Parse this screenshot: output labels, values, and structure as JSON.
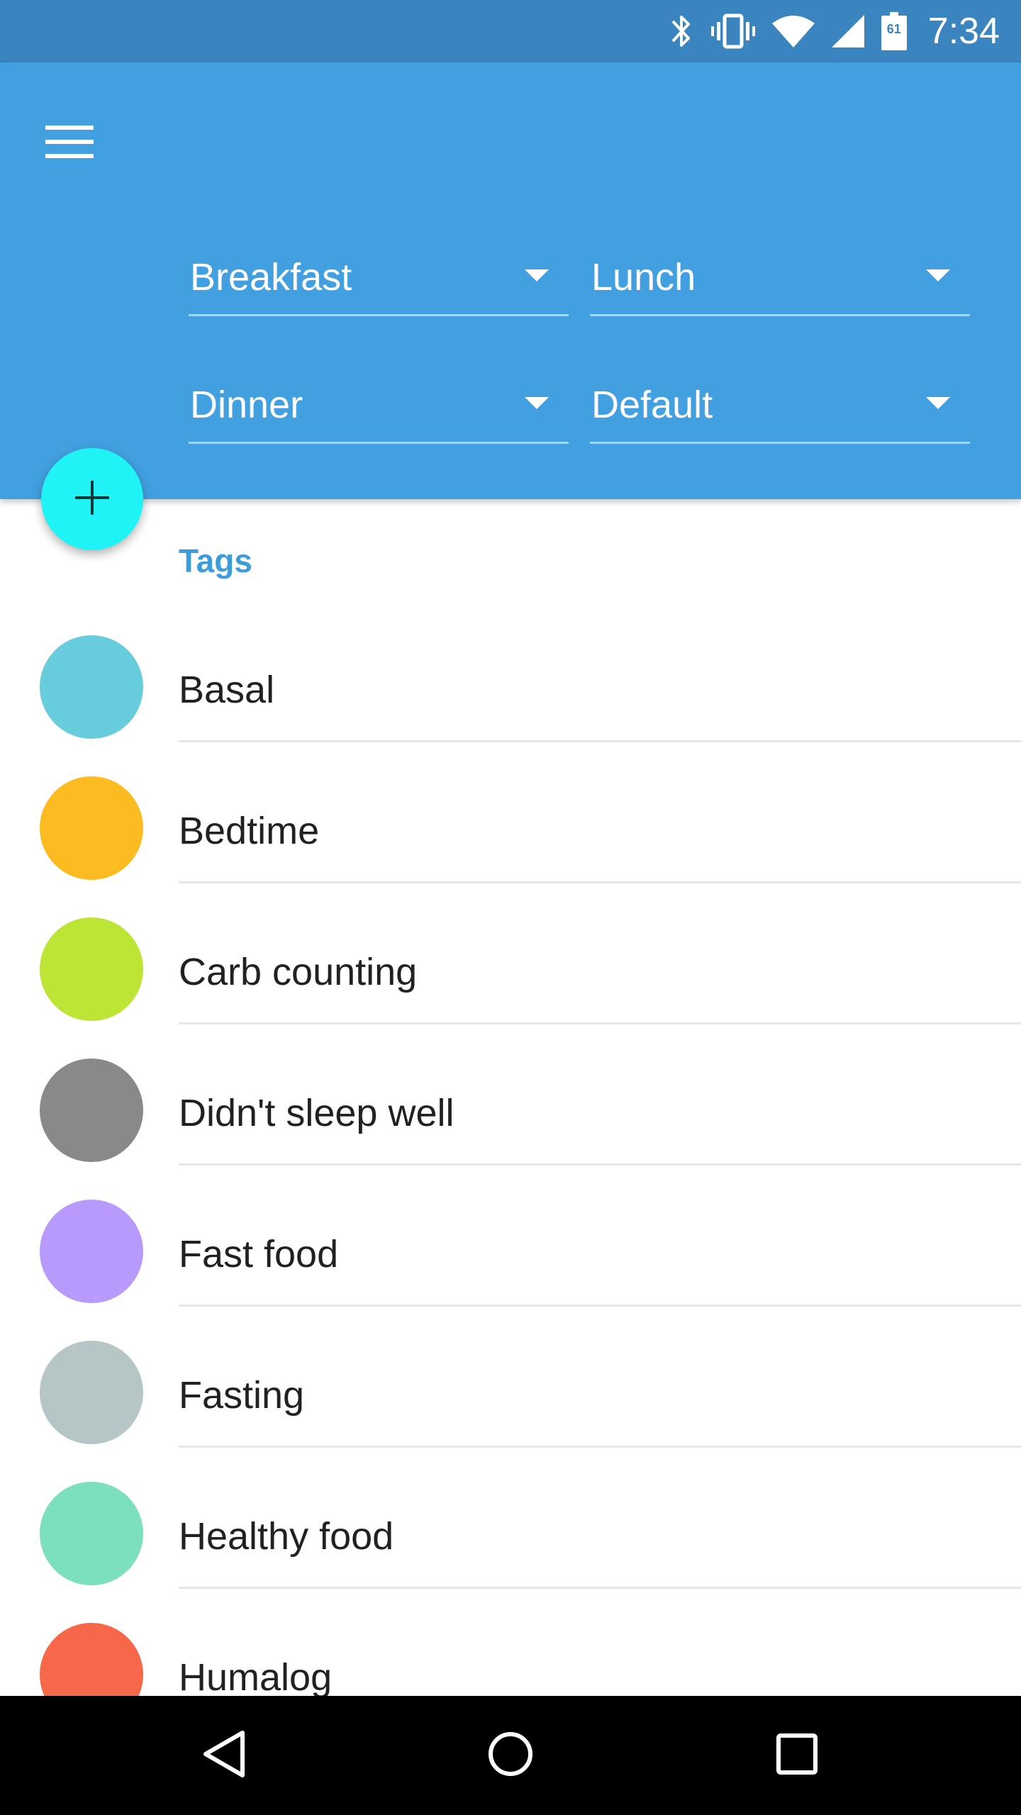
{
  "status_bar": {
    "time": "7:34",
    "battery_level": "61",
    "icons": [
      "bluetooth-icon",
      "vibrate-icon",
      "wifi-icon",
      "cell-signal-icon",
      "battery-icon"
    ]
  },
  "header": {
    "menu_icon": "hamburger-menu-icon",
    "dropdowns": [
      {
        "label": "Breakfast"
      },
      {
        "label": "Lunch"
      },
      {
        "label": "Dinner"
      },
      {
        "label": "Default"
      }
    ],
    "background_color": "#42a0e0"
  },
  "fab": {
    "icon": "plus-icon",
    "color": "#1ff3f5"
  },
  "tags": {
    "header": "Tags",
    "items": [
      {
        "label": "Basal",
        "color": "#67ccdc"
      },
      {
        "label": "Bedtime",
        "color": "#fdbb22"
      },
      {
        "label": "Carb counting",
        "color": "#bde536"
      },
      {
        "label": "Didn't sleep well",
        "color": "#898989"
      },
      {
        "label": "Fast food",
        "color": "#b79afc"
      },
      {
        "label": "Fasting",
        "color": "#b6c6c6"
      },
      {
        "label": "Healthy food",
        "color": "#7cdfbd"
      },
      {
        "label": "Humalog",
        "color": "#f66849"
      }
    ]
  },
  "nav_bar": {
    "icons": [
      "back-icon",
      "home-icon",
      "recents-icon"
    ]
  }
}
